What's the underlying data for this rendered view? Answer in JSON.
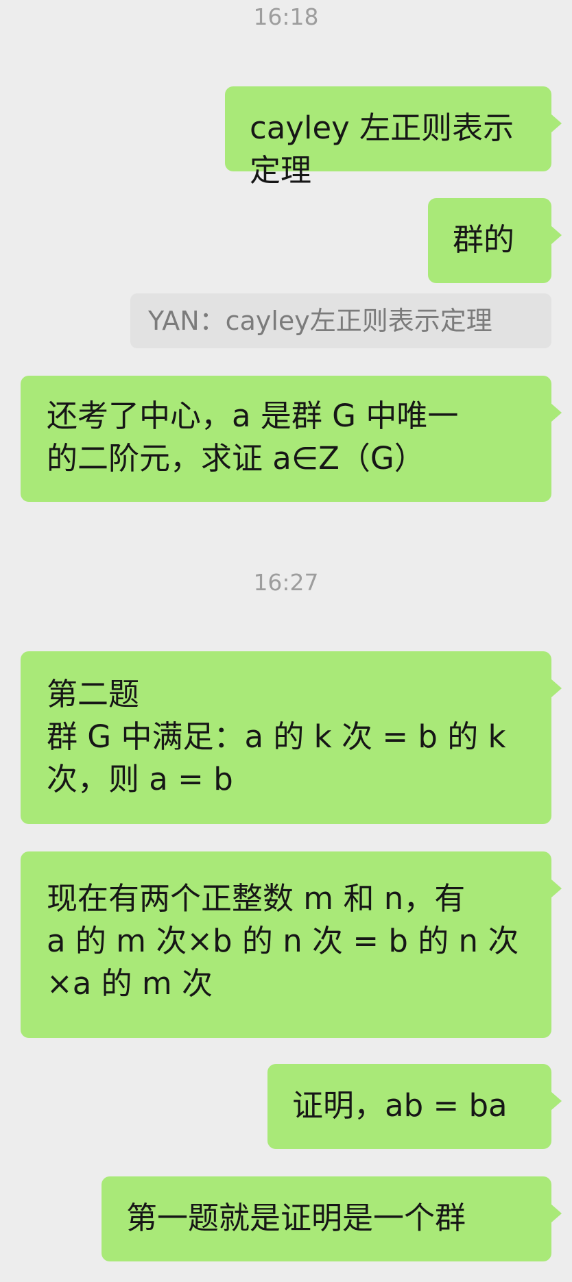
{
  "chat": {
    "timestamp_1": "16:18",
    "timestamp_2": "16:27",
    "messages": [
      {
        "text": "cayley 左正则表示定理"
      },
      {
        "text": "群的"
      },
      {
        "quote": "YAN：cayley左正则表示定理"
      },
      {
        "text": "还考了中心，a 是群 G 中唯一\n的二阶元，求证 a∈Z（G）"
      },
      {
        "text": "第二题\n群 G 中满足：a 的 k 次 = b 的 k\n次，则 a = b"
      },
      {
        "text": "现在有两个正整数 m 和 n，有\na 的 m 次×b 的 n 次 = b 的 n 次\n×a 的 m 次"
      },
      {
        "text": "证明，ab = ba"
      },
      {
        "text": "第一题就是证明是一个群"
      }
    ]
  },
  "colors": {
    "background": "#ededed",
    "bubble_green": "#a9e978",
    "quote_gray": "#e2e2e2",
    "timestamp_text": "#9d9d9d"
  }
}
